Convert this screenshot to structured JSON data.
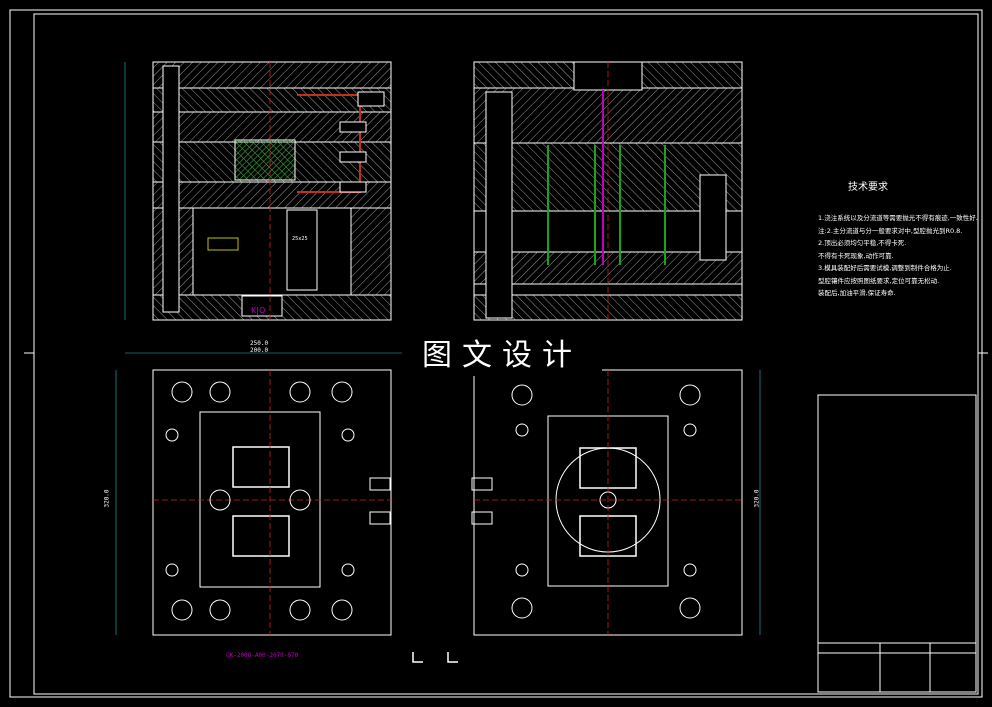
{
  "watermark": "图文设计",
  "technical_requirements": {
    "title": "技术要求",
    "lines": [
      "1.浇注系统以及分流道等需要抛光不得有痕迹,一致性好.",
      "注:2.主分流道与分一般要求对中,型腔抛光到R0.8.",
      "2.顶出必须均匀平稳,不得卡死.",
      "不得有卡死现象,动作可靠.",
      "3.模具装配好后需要试模,调整到制件合格为止.",
      "型腔镶件应按照图纸要求,定位可靠无松动.",
      "装配后,加油平滑,保证寿命."
    ]
  },
  "part_number": "CK-2008-A00-2070-070",
  "dimensions": {
    "width_outer": "250.0",
    "width_inner": "200.0",
    "height_left": "320.0",
    "height_right": "320.0"
  },
  "section_label": "K|O",
  "insert_label": "25x25"
}
